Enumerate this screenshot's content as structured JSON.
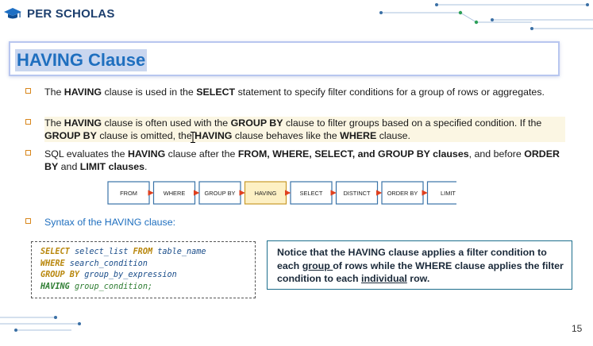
{
  "brand": {
    "name": "PER SCHOLAS"
  },
  "slide": {
    "title": "HAVING Clause",
    "page_number": "15"
  },
  "bullets": [
    {
      "p1": "The ",
      "b1": "HAVING",
      "p2": " clause is used in the ",
      "b2": "SELECT",
      "p3": " statement to specify filter conditions for a group of rows or aggregates."
    },
    {
      "p1": "The ",
      "b1": "HAVING",
      "p2": " clause is often used with the ",
      "b2": "GROUP BY",
      "p3": " clause to filter groups based on a specified condition. If the ",
      "b3": "GROUP BY",
      "p4": " clause is omitted, the ",
      "b4": "HAVING",
      "p5": " clause behaves like the ",
      "b5": "WHERE",
      "p6": " clause."
    },
    {
      "p1": "SQL evaluates the ",
      "b1": "HAVING",
      "p2": " clause after the ",
      "b2": "FROM, WHERE, SELECT, and GROUP BY clauses",
      "p3": ", and before ",
      "b3": "ORDER BY",
      "p4": " and ",
      "b4": "LIMIT clauses",
      "p5": "."
    }
  ],
  "flow_steps": [
    "FROM",
    "WHERE",
    "GROUP BY",
    "HAVING",
    "SELECT",
    "DISTINCT",
    "ORDER BY",
    "LIMIT"
  ],
  "flow_highlight_color": "#fdf0c4",
  "syntax_label": "Syntax of the HAVING clause:",
  "code": {
    "l1_kw": "SELECT",
    "l1_rest": " select_list ",
    "l1_kw2": "FROM",
    "l1_rest2": " table_name",
    "l2_kw": "WHERE",
    "l2_rest": " search_condition",
    "l3_kw": "GROUP BY",
    "l3_rest": " group_by_expression",
    "l4_kw": "HAVING",
    "l4_rest": " group_condition;"
  },
  "note": {
    "t1": "Notice that the HAVING clause applies a filter condition to each ",
    "u1": "group ",
    "t2": "of rows while the WHERE clause applies the filter condition to each ",
    "u2": "individual",
    "t3": " row."
  },
  "colors": {
    "brand": "#1d3f6e",
    "title": "#1f6fbf",
    "bullet": "#d8861b",
    "note_border": "#1c6e8c"
  }
}
